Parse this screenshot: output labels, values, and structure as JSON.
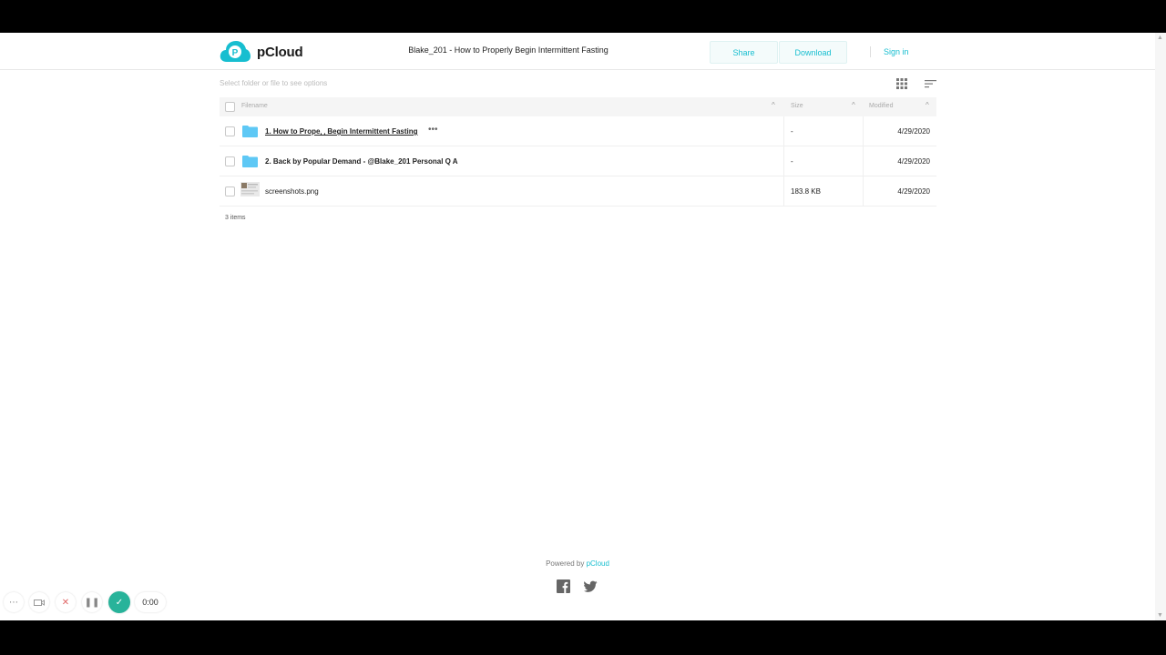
{
  "header": {
    "brand": "pCloud",
    "title": "Blake_201 - How to Properly Begin Intermittent Fasting",
    "share_label": "Share",
    "download_label": "Download",
    "signin_label": "Sign in"
  },
  "toolbar": {
    "hint": "Select folder or file to see options"
  },
  "table": {
    "columns": {
      "filename": "Filename",
      "size": "Size",
      "modified": "Modified"
    },
    "rows": [
      {
        "name": "1. How to Prope␣ Begin Intermittent Fasting",
        "size": "-",
        "modified": "4/29/2020",
        "type": "folder"
      },
      {
        "name": "2. Back by Popular Demand - @Blake_201 Personal Q A",
        "size": "-",
        "modified": "4/29/2020",
        "type": "folder"
      },
      {
        "name": "screenshots.png",
        "size": "183.8 KB",
        "modified": "4/29/2020",
        "type": "image"
      }
    ],
    "count": "3 items"
  },
  "footer": {
    "powered_prefix": "Powered by",
    "powered_brand": "pCloud"
  },
  "recorder": {
    "time": "0:00"
  },
  "colors": {
    "accent": "#17bed0",
    "folder": "#5ec8f5",
    "record_ok": "#28b39a"
  }
}
